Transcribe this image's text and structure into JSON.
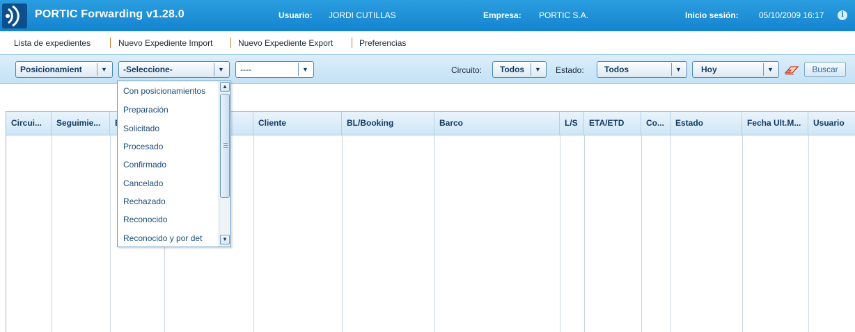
{
  "header": {
    "app_title": "PORTIC Forwarding v1.28.0",
    "user_label": "Usuario:",
    "user_value": "JORDI CUTILLAS",
    "company_label": "Empresa:",
    "company_value": "PORTIC S.A.",
    "session_label": "Inicio sesión:",
    "session_value": "05/10/2009 16:17",
    "info_icon": "info-icon",
    "colors": {
      "bar": "#1583cf",
      "logo_bg": "#0c4f8f"
    }
  },
  "nav": {
    "items": [
      {
        "label": "Lista de expedientes"
      },
      {
        "label": "Nuevo Expediente Import"
      },
      {
        "label": "Nuevo Expediente Export"
      },
      {
        "label": "Preferencias"
      }
    ],
    "separator_color": "#c77b2c"
  },
  "filters": {
    "type_select": "Posicionamient",
    "status_select": "-Seleccione-",
    "third_select": "----",
    "circuit_label": "Circuito:",
    "circuit_value": "Todos",
    "state_label": "Estado:",
    "state_value": "Todos",
    "date_value": "Hoy",
    "eraser_icon": "eraser-icon",
    "search_label": "Buscar"
  },
  "dropdown": {
    "options": [
      "Con posicionamientos",
      "Preparación",
      "Solicitado",
      "Procesado",
      "Confirmado",
      "Cancelado",
      "Rechazado",
      "Reconocido",
      "Reconocido y por det"
    ]
  },
  "table": {
    "columns": [
      "Circui...",
      "Seguimie...",
      "E",
      "",
      "Cliente",
      "BL/Booking",
      "Barco",
      "L/S",
      "ETA/ETD",
      "Co...",
      "Estado",
      "Fecha Ult.M...",
      "Usuario"
    ],
    "rows": []
  }
}
